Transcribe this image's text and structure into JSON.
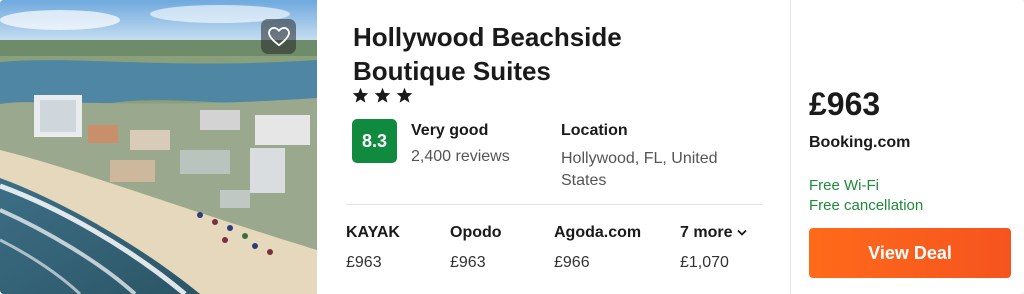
{
  "hotel": {
    "name": "Hollywood Beachside Boutique Suites",
    "star_rating": 3,
    "score": "8.3",
    "rating_label": "Very good",
    "reviews": "2,400 reviews",
    "location_label": "Location",
    "location": "Hollywood, FL, United States"
  },
  "providers": [
    {
      "name": "KAYAK",
      "price": "£963"
    },
    {
      "name": "Opodo",
      "price": "£963"
    },
    {
      "name": "Agoda.com",
      "price": "£966"
    }
  ],
  "more": {
    "label": "7 more",
    "price": "£1,070"
  },
  "deal": {
    "price": "£963",
    "site": "Booking.com",
    "amenities": [
      "Free Wi-Fi",
      "Free cancellation"
    ],
    "button_label": "View Deal"
  },
  "colors": {
    "score_bg": "#0f8a3f",
    "amenity_text": "#1f8a3a",
    "button": "#f5541e"
  },
  "icons": {
    "favorite": "heart-outline-icon",
    "star": "star-icon",
    "more": "chevron-down-icon"
  }
}
